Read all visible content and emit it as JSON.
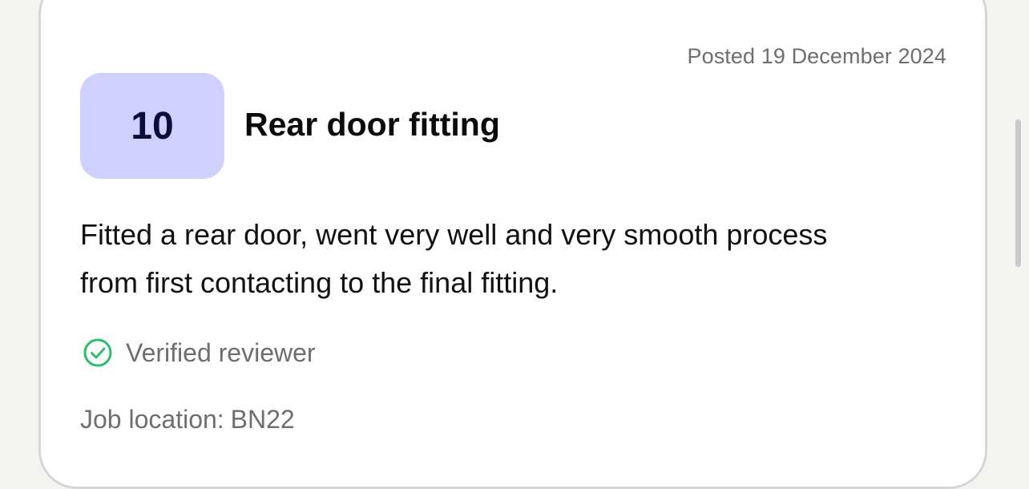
{
  "review": {
    "posted_date": "Posted 19 December 2024",
    "score": "10",
    "title": "Rear door fitting",
    "text": "Fitted a rear door, went very well and very smooth process from first contacting to the final fitting.",
    "verified_label": "Verified reviewer",
    "location_label": "Job location:",
    "location_value": "BN22"
  },
  "colors": {
    "badge_bg": "#cfd0fd",
    "badge_text": "#0b0d3a",
    "verified_green": "#2dbd6e"
  },
  "icons": {
    "verified": "check-circle-icon"
  }
}
